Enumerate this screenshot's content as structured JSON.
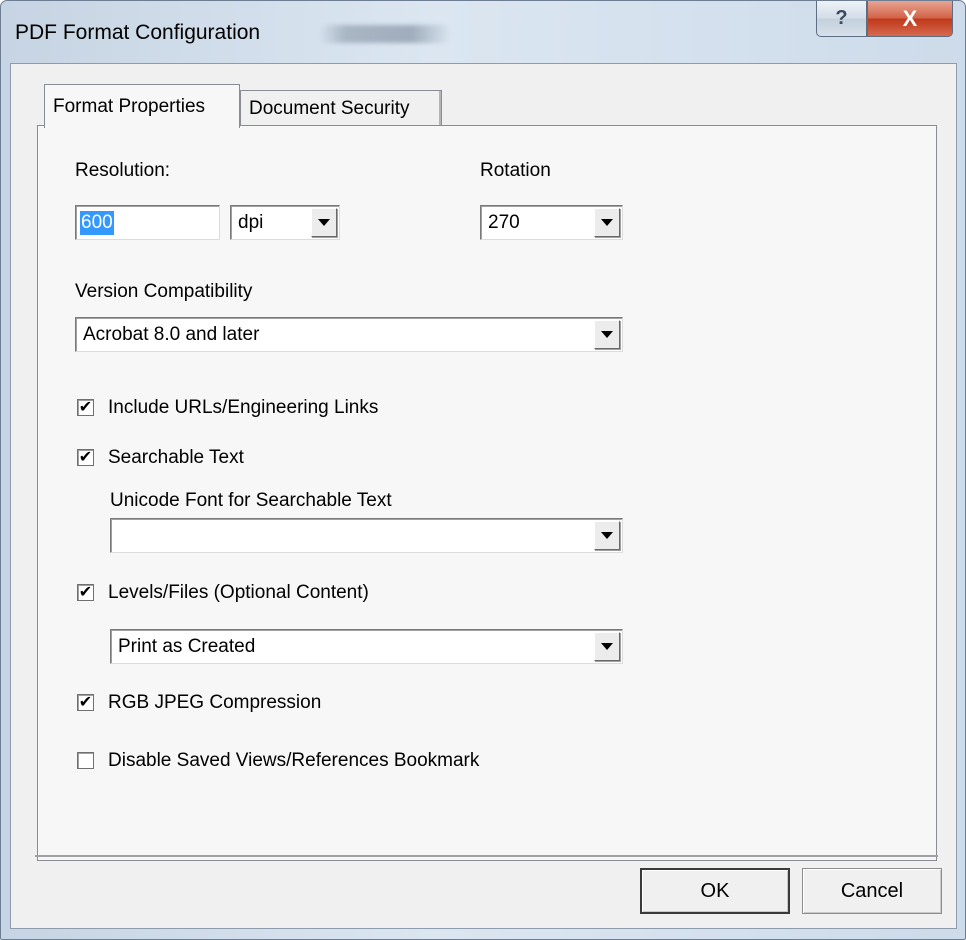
{
  "window": {
    "title": "PDF Format Configuration",
    "help_glyph": "?",
    "close_glyph": "X"
  },
  "tabs": [
    {
      "label": "Format Properties",
      "active": true
    },
    {
      "label": "Document Security",
      "active": false
    }
  ],
  "format": {
    "resolution_label": "Resolution:",
    "resolution_value": "600",
    "resolution_unit": "dpi",
    "rotation_label": "Rotation",
    "rotation_value": "270",
    "version_label": "Version Compatibility",
    "version_value": "Acrobat 8.0 and later",
    "include_urls": {
      "label": "Include URLs/Engineering Links",
      "checked": true,
      "mark": "✔"
    },
    "searchable_text": {
      "label": "Searchable Text",
      "checked": true,
      "mark": "✔"
    },
    "unicode_font_label": "Unicode Font for Searchable Text",
    "unicode_font_value": "",
    "levels_files": {
      "label": "Levels/Files (Optional Content)",
      "checked": true,
      "mark": "✔"
    },
    "levels_mode_value": "Print as Created",
    "rgb_jpeg": {
      "label": "RGB JPEG Compression",
      "checked": true,
      "mark": "✔"
    },
    "disable_saved_views": {
      "label": "Disable Saved Views/References Bookmark",
      "checked": false,
      "mark": ""
    }
  },
  "buttons": {
    "ok": "OK",
    "cancel": "Cancel"
  }
}
